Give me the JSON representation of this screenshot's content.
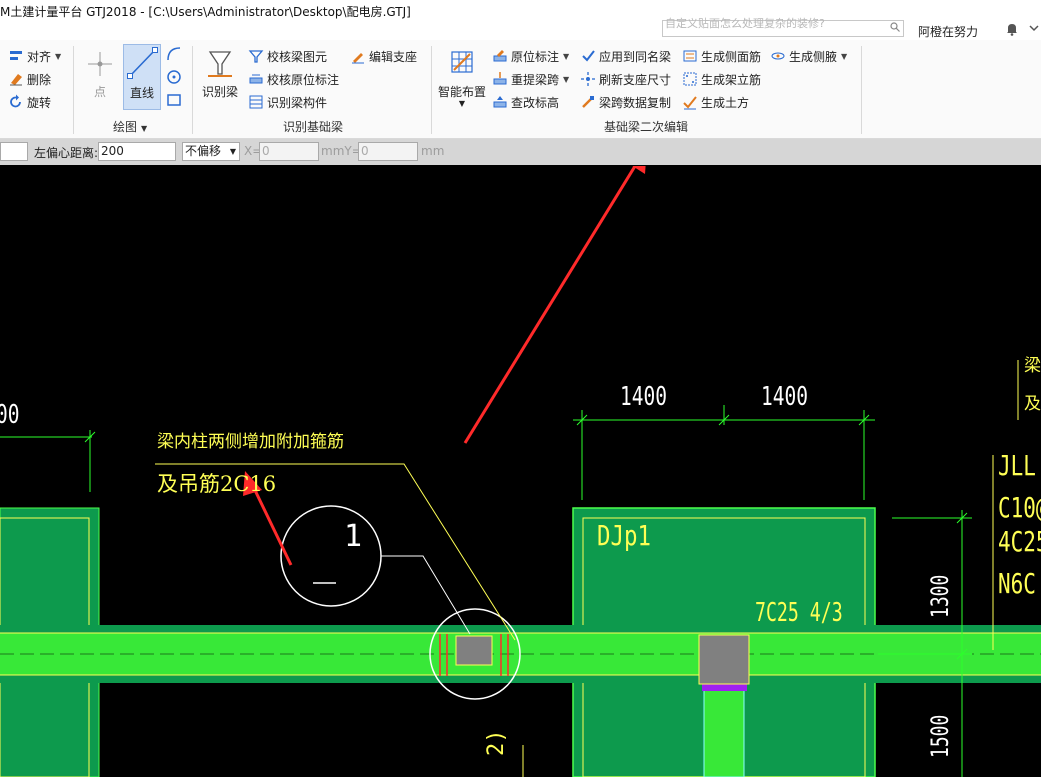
{
  "titlebar": {
    "title": "M土建计量平台 GTJ2018 - [C:\\Users\\Administrator\\Desktop\\配电房.GTJ]",
    "search_placeholder": "自定义贴面怎么处理复杂的装修?",
    "username": "阿橙在努力"
  },
  "ribbon": {
    "edit_group": {
      "align": "对齐",
      "delete": "删除",
      "rotate": "旋转"
    },
    "draw_group": {
      "point": "点",
      "line": "直线",
      "label": "绘图"
    },
    "identify_group": {
      "identify_beam": "识别梁",
      "check_beam": "校核梁图元",
      "check_original": "校核原位标注",
      "identify_member": "识别梁构件",
      "edit_support": "编辑支座",
      "label": "识别基础梁"
    },
    "secondary_group": {
      "smart_layout": "智能布置",
      "original_mark": "原位标注",
      "reextract_span": "重提梁跨",
      "modify_elevation": "查改标高",
      "apply_same_name": "应用到同名梁",
      "refresh_support": "刷新支座尺寸",
      "copy_span_data": "梁跨数据复制",
      "gen_side_rebar": "生成侧面筋",
      "gen_stirrup_legs": "生成架立筋",
      "gen_earthwork": "生成土方",
      "gen_haunch": "生成侧腋",
      "label": "基础梁二次编辑"
    }
  },
  "options_bar": {
    "left_offset_label": "左偏心距离:",
    "left_offset_value": "200",
    "offset_mode": "不偏移",
    "x_label": "X=",
    "x_value": "0",
    "mm_y_label": "mmY=",
    "y_value": "0",
    "mm_label": "mm"
  },
  "canvas": {
    "dim_left": "00",
    "dim_1": "1400",
    "dim_2": "1400",
    "dim_v1": "1300",
    "dim_v2": "1500",
    "note_line1": "梁内柱两侧增加附加箍筋",
    "note_line2": "及吊筋2C16",
    "section_num": "1",
    "footing_label": "DJp1",
    "rebar_label": "7C25 4/3",
    "right_jll": "JLL",
    "right_c10": "C10@",
    "right_4c25": "4C25",
    "right_n6c": "N6C",
    "right_top_a": "梁内",
    "right_top_b": "及吊",
    "bottom_partial": "2)",
    "colors": {
      "footing_fill": "#0d9a4d",
      "beam_fill": "#38e838",
      "annotation_yellow": "#ffff55",
      "dimension_green": "#2bff2b",
      "arrow_red": "#ff2a2a"
    }
  }
}
